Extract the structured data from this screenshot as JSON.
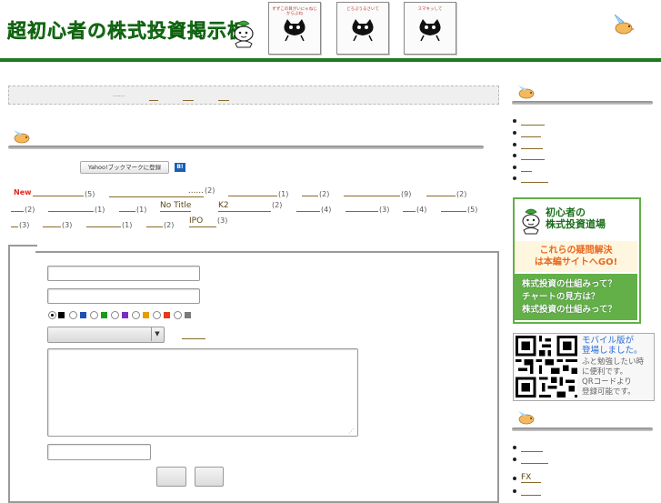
{
  "header": {
    "site_title": "超初心者の株式投資掲示板",
    "banners": [
      {
        "caption": "ずずこの目がいにゃねじからぶね"
      },
      {
        "caption": "どろぷうるさいて"
      },
      {
        "caption": "スマキッして"
      }
    ]
  },
  "nav": {
    "items": [
      "......",
      "",
      "",
      ""
    ]
  },
  "bookmarks": {
    "yahoo_label": "Yahoo!ブックマークに登録",
    "hatena_label": "B!"
  },
  "categories": {
    "new_label": "New",
    "row1": [
      {
        "label": "",
        "count": "(5)"
      },
      {
        "label": "......",
        "count": "(2)"
      },
      {
        "label": "",
        "count": "(1)"
      },
      {
        "label": "",
        "count": "(2)"
      },
      {
        "label": "",
        "count": "(9)"
      },
      {
        "label": "",
        "count": "(2)"
      }
    ],
    "row2": [
      {
        "label": "",
        "count": "(2)"
      },
      {
        "label": "",
        "count": "(1)"
      },
      {
        "label": "",
        "count": "(1)"
      },
      {
        "label": "No Title",
        "count": ""
      },
      {
        "label": "K2",
        "count": "(2)"
      },
      {
        "label": "",
        "count": "(4)"
      },
      {
        "label": "",
        "count": "(3)"
      },
      {
        "label": "",
        "count": "(4)"
      },
      {
        "label": "",
        "count": "(5)"
      }
    ],
    "row3": [
      {
        "label": "",
        "count": "(3)"
      },
      {
        "label": "",
        "count": "(3)"
      },
      {
        "label": "",
        "count": "(1)"
      },
      {
        "label": "",
        "count": "(2)"
      },
      {
        "label": "IPO",
        "count": "(3)"
      }
    ]
  },
  "form": {
    "name_value": "",
    "email_value": "",
    "colors": [
      "#000000",
      "#1f4fb5",
      "#1a9a1a",
      "#7a2fc0",
      "#e89a00",
      "#e83a1a",
      "#7a7a7a",
      "#ff6fd0"
    ],
    "select_value": "",
    "body_value": "",
    "password_value": ""
  },
  "sidebar": {
    "list1": [
      "",
      "",
      "",
      "",
      "",
      ""
    ],
    "dojo": {
      "title_line1": "初心者の",
      "title_line2": "株式投資道場",
      "cta_line1": "これらの疑問解決",
      "cta_line2": "は本編サイトへGO!",
      "q1": "株式投資の仕組みって？",
      "q2": "チャートの見方は？",
      "q3": "株式投資の仕組みって？"
    },
    "mobile": {
      "title_line1": "モバイル版が",
      "title_line2": "登場しました。",
      "desc_line1": "ふと勉強したい時",
      "desc_line2": "に便利です。",
      "desc_line3": "QRコードより",
      "desc_line4": "登録可能です。"
    },
    "list2": [
      "",
      "",
      "FX",
      ""
    ]
  }
}
